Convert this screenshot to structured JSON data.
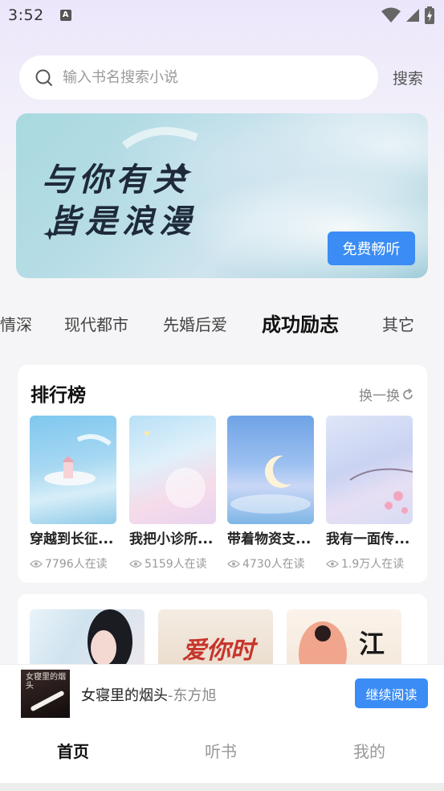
{
  "status_bar": {
    "time": "3:52",
    "app_icon_letter": "A"
  },
  "search": {
    "placeholder": "输入书名搜索小说",
    "value": "",
    "button_label": "搜索"
  },
  "banner": {
    "line1": "与你有关",
    "line2": "皆是浪漫",
    "button_label": "免费畅听"
  },
  "category_tabs": [
    {
      "label": "情深",
      "active": false
    },
    {
      "label": "现代都市",
      "active": false
    },
    {
      "label": "先婚后爱",
      "active": false
    },
    {
      "label": "成功励志",
      "active": true
    },
    {
      "label": "其它",
      "active": false
    }
  ],
  "ranking": {
    "title": "排行榜",
    "refresh_label": "换一换",
    "books": [
      {
        "title": "穿越到长征...",
        "reads": "7796人在读"
      },
      {
        "title": "我把小诊所...",
        "reads": "5159人在读"
      },
      {
        "title": "带着物资支...",
        "reads": "4730人在读"
      },
      {
        "title": "我有一面传...",
        "reads": "1.9万人在读"
      }
    ]
  },
  "second_section": {
    "cover_texts": [
      "",
      "爱你时",
      "江"
    ]
  },
  "now_playing": {
    "title": "女寝里的烟头",
    "author": "-东方旭",
    "cover_text": "女寝里的烟头",
    "button_label": "继续阅读"
  },
  "bottom_tabs": [
    {
      "label": "首页",
      "active": true
    },
    {
      "label": "听书",
      "active": false
    },
    {
      "label": "我的",
      "active": false
    }
  ],
  "colors": {
    "accent": "#3b8cf5",
    "background": "#f5f5f7"
  },
  "icons": [
    "search-icon",
    "eye-icon",
    "refresh-icon",
    "wifi-icon",
    "signal-icon",
    "battery-icon"
  ]
}
